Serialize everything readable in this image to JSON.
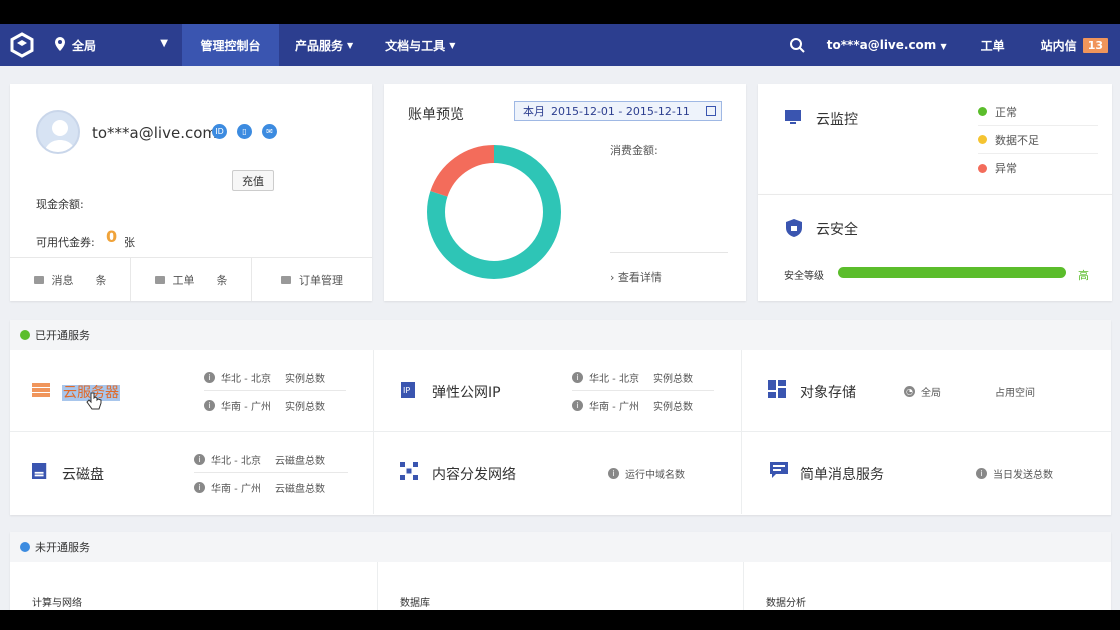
{
  "nav": {
    "region": "全局",
    "items": [
      {
        "label": "管理控制台",
        "active": true
      },
      {
        "label": "产品服务",
        "dropdown": true
      },
      {
        "label": "文档与工具",
        "dropdown": true
      }
    ],
    "user": "to***a@live.com",
    "ticket": "工单",
    "messages": "站内信",
    "message_count": "13"
  },
  "profile": {
    "email": "to***a@live.com",
    "cash_label": "现金余额:",
    "recharge": "充值",
    "coupon_label": "可用代金券:",
    "coupon_count": "0",
    "coupon_unit": "张",
    "footer": [
      {
        "label": "消息",
        "suffix": "条"
      },
      {
        "label": "工单",
        "suffix": "条"
      },
      {
        "label": "订单管理",
        "suffix": ""
      }
    ]
  },
  "bill": {
    "title": "账单预览",
    "range_label": "本月",
    "range": "2015-12-01 - 2015-12-11",
    "amount_label": "消费金额:",
    "detail": "查看详情",
    "donut": [
      {
        "value": 80,
        "color": "#2ec5b6"
      },
      {
        "value": 20,
        "color": "#f36c5b"
      }
    ]
  },
  "monitor": {
    "title": "云监控",
    "statuses": [
      {
        "label": "正常",
        "color": "#5bbd2b"
      },
      {
        "label": "数据不足",
        "color": "#f5c431"
      },
      {
        "label": "异常",
        "color": "#f36c5b"
      }
    ]
  },
  "security": {
    "title": "云安全",
    "level_label": "安全等级",
    "level_value": "高",
    "level_fraction": 1.0
  },
  "opened": {
    "header": "已开通服务",
    "services": [
      {
        "name": "云服务器",
        "metas": [
          [
            "华北 - 北京",
            "实例总数"
          ],
          [
            "华南 - 广州",
            "实例总数"
          ]
        ]
      },
      {
        "name": "弹性公网IP",
        "metas": [
          [
            "华北 - 北京",
            "实例总数"
          ],
          [
            "华南 - 广州",
            "实例总数"
          ]
        ]
      },
      {
        "name": "对象存储",
        "metas": [
          [
            "全局",
            "占用空间"
          ]
        ]
      },
      {
        "name": "云磁盘",
        "metas": [
          [
            "华北 - 北京",
            "云磁盘总数"
          ],
          [
            "华南 - 广州",
            "云磁盘总数"
          ]
        ]
      },
      {
        "name": "内容分发网络",
        "metas": [
          [
            "运行中域名数",
            ""
          ]
        ]
      },
      {
        "name": "简单消息服务",
        "metas": [
          [
            "当日发送总数",
            ""
          ]
        ]
      }
    ]
  },
  "unopened": {
    "header": "未开通服务",
    "categories": [
      "计算与网络",
      "数据库",
      "数据分析"
    ]
  }
}
